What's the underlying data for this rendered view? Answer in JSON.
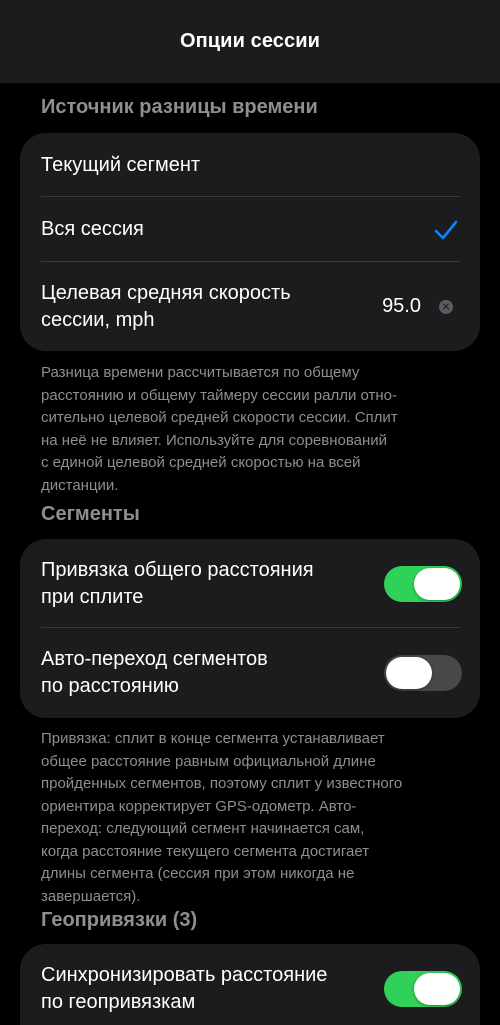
{
  "navbar": {
    "title": "Опции сессии"
  },
  "time_source": {
    "header": "Источник разницы времени",
    "rows": [
      {
        "label": "Текущий сегмент",
        "selected": false
      },
      {
        "label": "Вся сессия",
        "selected": true
      },
      {
        "label": "Целевая средняя скорость\nсессии, mph",
        "value": "95.0",
        "clear_icon": "clear-icon"
      }
    ],
    "footnote": "Разница времени рассчитывается по общему\nрасстоянию и общему таймеру сессии ралли отно-\nсительно целевой средней скорости сессии. Сплит\nна неё не влияет. Используйте для соревнований\nс единой целевой средней скоростью на всей\nдистанции."
  },
  "segments": {
    "header": "Сегменты",
    "rows": [
      {
        "label": "Привязка общего расстояния\nпри сплите",
        "toggle": true
      },
      {
        "label": "Авто-переход сегментов\nпо расстоянию",
        "toggle": false
      }
    ],
    "footnote": "Привязка: сплит в конце сегмента устанавливает\nобщее расстояние равным официальной длине\nпройденных сегментов, поэтому сплит у известного\nориентира корректирует GPS-одометр. Авто-\nпереход: следующий сегмент начинается сам,\nкогда расстояние текущего сегмента достигает\nдлины сегмента (сессия при этом никогда не\nзавершается)."
  },
  "geofences": {
    "header": "Геопривязки (3)",
    "rows": [
      {
        "label": "Синхронизировать расстояние\nпо геопривязкам",
        "toggle": true
      }
    ]
  },
  "colors": {
    "accent": "#0a84ff",
    "toggle_on": "#30d158",
    "toggle_off": "#48484a",
    "group_bg": "#1c1c1e",
    "secondary_text": "#8e8e93"
  }
}
